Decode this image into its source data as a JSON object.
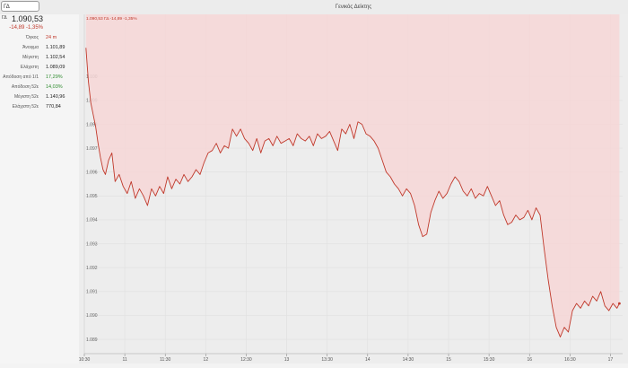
{
  "search": {
    "value": "ΓΔ"
  },
  "window": {
    "title": "Γενικός Δείκτης"
  },
  "quote": {
    "symbol": "ΓΔ",
    "price": "1.090,53",
    "change": "-14,89  -1,35%",
    "legend": "1.090,53  ΓΔ  -14,89 -1,35%",
    "stats": [
      {
        "label": "Όγκος",
        "value": "24 m",
        "color": "red"
      },
      {
        "label": "Άνοιγμα",
        "value": "1.101,89",
        "color": "black"
      },
      {
        "label": "Μέγιστη",
        "value": "1.102,54",
        "color": "black"
      },
      {
        "label": "Ελάχιστη",
        "value": "1.089,09",
        "color": "black"
      },
      {
        "label": "Απόδοση από 1/1",
        "value": "17,29%",
        "color": "green"
      },
      {
        "label": "Απόδοση 52ε",
        "value": "14,03%",
        "color": "green"
      },
      {
        "label": "Μέγιστη 52ε",
        "value": "1.140,96",
        "color": "black"
      },
      {
        "label": "Ελάχιστη 52ε",
        "value": "770,84",
        "color": "black"
      }
    ]
  },
  "chart_data": {
    "type": "area",
    "title": "",
    "xlabel": "",
    "ylabel": "",
    "grid": true,
    "y_ticks": [
      "1.100",
      "1.099",
      "1.098",
      "1.097",
      "1.096",
      "1.095",
      "1.094",
      "1.093",
      "1.092",
      "1.091",
      "1.090",
      "1.089"
    ],
    "y_tick_values": [
      1100,
      1099,
      1098,
      1097,
      1096,
      1095,
      1094,
      1093,
      1092,
      1091,
      1090,
      1089
    ],
    "ylim": [
      1088.4,
      1102.6
    ],
    "x_ticks": [
      "10:30",
      "11",
      "11:30",
      "12",
      "12:30",
      "13",
      "13:30",
      "14",
      "14:30",
      "15",
      "15:30",
      "16",
      "16:30",
      "17"
    ],
    "x_tick_values": [
      10.5,
      11,
      11.5,
      12,
      12.5,
      13,
      13.5,
      14,
      14.5,
      15,
      15.5,
      16,
      16.5,
      17
    ],
    "xlim": [
      10.5,
      17.15
    ],
    "series": [
      {
        "color": "#c0392b",
        "fill": "#f6d6d6",
        "x": [
          10.52,
          10.55,
          10.58,
          10.61,
          10.64,
          10.67,
          10.7,
          10.73,
          10.76,
          10.8,
          10.84,
          10.88,
          10.93,
          10.98,
          11.03,
          11.08,
          11.13,
          11.18,
          11.23,
          11.28,
          11.33,
          11.38,
          11.43,
          11.48,
          11.53,
          11.58,
          11.63,
          11.68,
          11.73,
          11.78,
          11.83,
          11.88,
          11.93,
          11.98,
          12.03,
          12.08,
          12.13,
          12.18,
          12.23,
          12.28,
          12.33,
          12.38,
          12.43,
          12.48,
          12.53,
          12.58,
          12.63,
          12.68,
          12.73,
          12.78,
          12.83,
          12.88,
          12.93,
          12.98,
          13.03,
          13.08,
          13.13,
          13.18,
          13.23,
          13.28,
          13.33,
          13.38,
          13.43,
          13.48,
          13.53,
          13.58,
          13.63,
          13.68,
          13.73,
          13.78,
          13.83,
          13.88,
          13.93,
          13.98,
          14.03,
          14.08,
          14.13,
          14.18,
          14.23,
          14.28,
          14.33,
          14.38,
          14.43,
          14.48,
          14.53,
          14.58,
          14.63,
          14.68,
          14.73,
          14.78,
          14.83,
          14.88,
          14.93,
          14.98,
          15.03,
          15.08,
          15.13,
          15.18,
          15.23,
          15.28,
          15.33,
          15.38,
          15.43,
          15.48,
          15.53,
          15.58,
          15.63,
          15.68,
          15.73,
          15.78,
          15.83,
          15.88,
          15.93,
          15.98,
          16.03,
          16.08,
          16.13,
          16.18,
          16.23,
          16.28,
          16.33,
          16.38,
          16.43,
          16.48,
          16.53,
          16.58,
          16.63,
          16.68,
          16.73,
          16.78,
          16.83,
          16.88,
          16.93,
          16.98,
          17.03,
          17.08,
          17.11
        ],
        "values": [
          1101.2,
          1099.8,
          1098.9,
          1098.4,
          1097.9,
          1097.2,
          1096.6,
          1096.1,
          1095.9,
          1096.5,
          1096.8,
          1095.6,
          1095.9,
          1095.4,
          1095.1,
          1095.6,
          1094.9,
          1095.3,
          1095.0,
          1094.6,
          1095.3,
          1095.0,
          1095.4,
          1095.1,
          1095.8,
          1095.3,
          1095.7,
          1095.5,
          1095.9,
          1095.6,
          1095.8,
          1096.1,
          1095.9,
          1096.4,
          1096.8,
          1096.9,
          1097.2,
          1096.8,
          1097.1,
          1097.0,
          1097.8,
          1097.5,
          1097.8,
          1097.4,
          1097.2,
          1096.9,
          1097.4,
          1096.8,
          1097.3,
          1097.4,
          1097.1,
          1097.5,
          1097.2,
          1097.3,
          1097.4,
          1097.1,
          1097.6,
          1097.4,
          1097.3,
          1097.5,
          1097.1,
          1097.6,
          1097.4,
          1097.5,
          1097.7,
          1097.3,
          1096.9,
          1097.8,
          1097.6,
          1098.0,
          1097.4,
          1098.1,
          1098.0,
          1097.6,
          1097.5,
          1097.3,
          1097.0,
          1096.5,
          1096.0,
          1095.8,
          1095.5,
          1095.3,
          1095.0,
          1095.3,
          1095.1,
          1094.6,
          1093.8,
          1093.3,
          1093.4,
          1094.3,
          1094.8,
          1095.2,
          1094.9,
          1095.1,
          1095.5,
          1095.8,
          1095.6,
          1095.2,
          1095.0,
          1095.3,
          1094.9,
          1095.1,
          1095.0,
          1095.4,
          1095.0,
          1094.6,
          1094.8,
          1094.2,
          1093.8,
          1093.9,
          1094.2,
          1094.0,
          1094.1,
          1094.4,
          1094.0,
          1094.5,
          1094.2,
          1092.8,
          1091.5,
          1090.4,
          1089.5,
          1089.1,
          1089.5,
          1089.3,
          1090.2,
          1090.5,
          1090.3,
          1090.6,
          1090.4,
          1090.8,
          1090.6,
          1091.0,
          1090.4,
          1090.2,
          1090.5,
          1090.3,
          1090.5
        ]
      }
    ]
  }
}
